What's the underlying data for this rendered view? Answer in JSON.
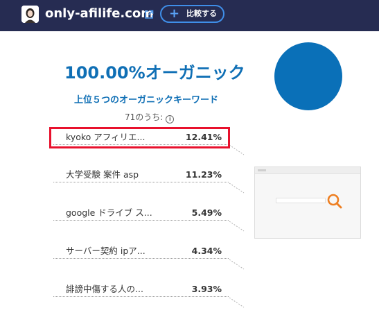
{
  "header": {
    "domain": "only-afilife.com",
    "compare_label": "比較する",
    "compare_icon": "plus-icon",
    "external_icon": "external-link-icon",
    "background": "#262c52",
    "accent": "#3f8ee8"
  },
  "summary": {
    "headline": "100.00%オーガニック",
    "subhead": "上位５つのオーガニックキーワード",
    "count_text": "71のうち:",
    "info_icon": "i",
    "organic_share": 1.0,
    "pie_color": "#0a70b8"
  },
  "keywords": [
    {
      "label": "kyoko アフィリエ...",
      "pct": "12.41%",
      "highlighted": true
    },
    {
      "label": "大学受験 案件 asp",
      "pct": "11.23%"
    },
    {
      "label": "google ドライブ ス...",
      "pct": "5.49%"
    },
    {
      "label": "サーバー契約 ipア...",
      "pct": "4.34%"
    },
    {
      "label": "誹謗中傷する人の...",
      "pct": "3.93%"
    }
  ],
  "preview": {
    "icon": "search-magnifier-icon",
    "accent": "#ee7f22",
    "highlight_color": "#e8112d"
  }
}
